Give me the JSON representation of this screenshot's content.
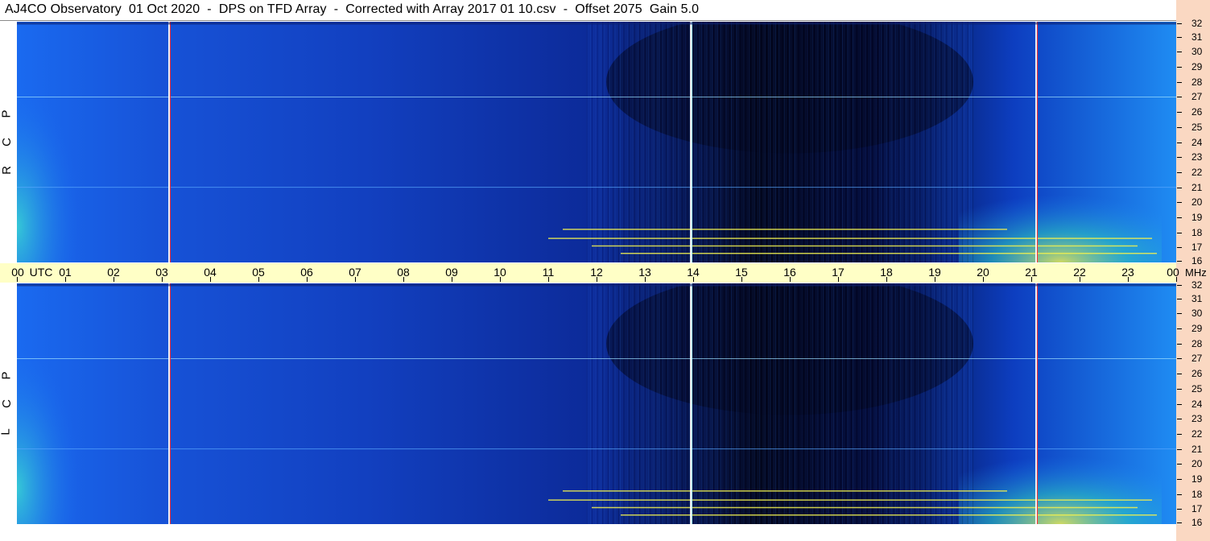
{
  "title": "AJ4CO Observatory  01 Oct 2020  -  DPS on TFD Array  -  Corrected with Array 2017 01 10.csv  -  Offset 2075  Gain 5.0",
  "panels": {
    "rcp": {
      "letters": [
        "R",
        "C",
        "P"
      ]
    },
    "lcp": {
      "letters": [
        "L",
        "C",
        "P"
      ]
    }
  },
  "colors": {
    "background": "#ffffff",
    "time_band": "#ffffc6",
    "freq_strip": "#fad8c2",
    "spectrogram_low": "#03061c",
    "spectrogram_mid": "#1240c0",
    "spectrogram_high": "#1f8cf3",
    "signal_hot": "#f0f050"
  },
  "chart_data": {
    "type": "heatmap",
    "x_tick_labels": [
      "00",
      "01",
      "02",
      "03",
      "04",
      "05",
      "06",
      "07",
      "08",
      "09",
      "10",
      "11",
      "12",
      "13",
      "14",
      "15",
      "16",
      "17",
      "18",
      "19",
      "20",
      "21",
      "22",
      "23",
      "00"
    ],
    "x_unit_label": "UTC",
    "y_tick_labels": [
      "16",
      "17",
      "18",
      "19",
      "20",
      "21",
      "22",
      "23",
      "24",
      "25",
      "26",
      "27",
      "28",
      "29",
      "30",
      "31",
      "32"
    ],
    "y_unit_label": "MHz",
    "xlim": [
      0,
      24
    ],
    "ylim": [
      16,
      32
    ],
    "vertical_markers_utc": [
      {
        "utc": 3.15,
        "color": "#ff3030"
      },
      {
        "utc": 13.95,
        "color": "#a8f0ff"
      },
      {
        "utc": 21.1,
        "color": "#ff3030"
      }
    ],
    "horizontal_bands_mhz": [
      {
        "mhz": 27.0,
        "color": "#9ee0ff"
      },
      {
        "mhz": 21.0,
        "color": "#5aa8ff"
      }
    ],
    "dark_region": {
      "utc_start": 12.2,
      "utc_end": 19.8,
      "mhz_start": 22.5,
      "mhz_end": 32
    },
    "hot_region": {
      "utc_start": 19.5,
      "utc_end": 23.7,
      "mhz_start": 16,
      "mhz_end": 22
    },
    "interference_lines": [
      {
        "mhz": 17.6,
        "utc_start": 11.0,
        "utc_end": 23.5
      },
      {
        "mhz": 17.1,
        "utc_start": 11.9,
        "utc_end": 23.2
      },
      {
        "mhz": 16.6,
        "utc_start": 12.5,
        "utc_end": 23.6
      },
      {
        "mhz": 18.2,
        "utc_start": 11.3,
        "utc_end": 20.5
      }
    ]
  }
}
